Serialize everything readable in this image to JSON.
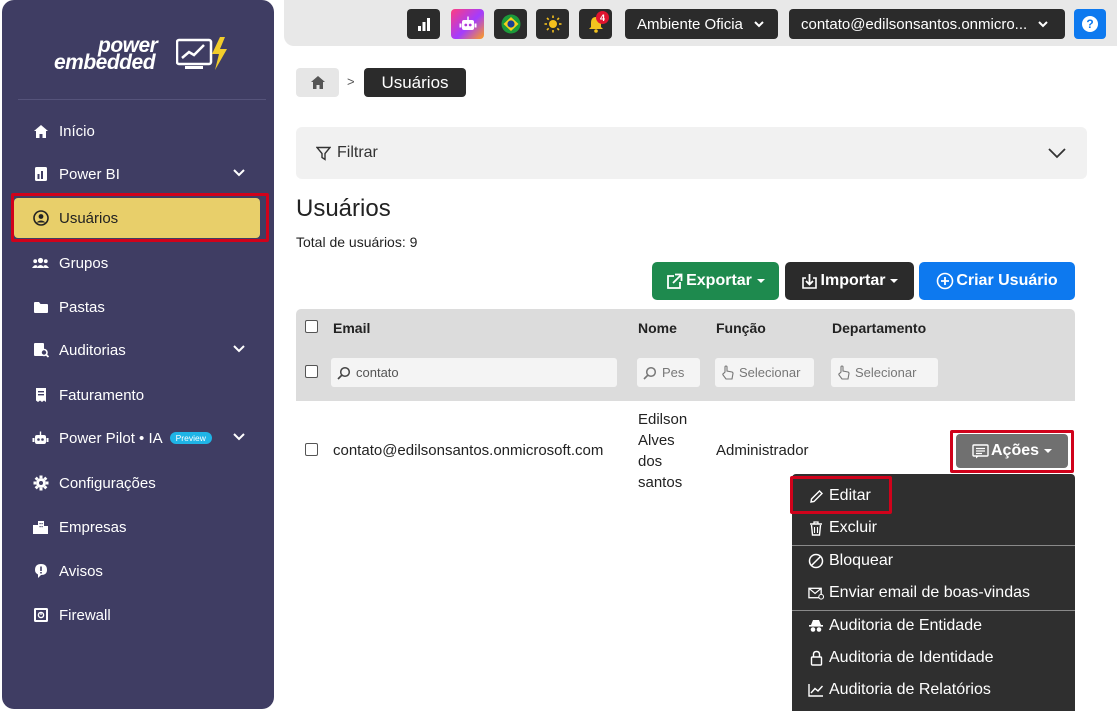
{
  "logo": {
    "line1": "power",
    "line2": "embedded"
  },
  "sidebar": {
    "items": [
      {
        "label": "Início",
        "icon": "home-icon"
      },
      {
        "label": "Power BI",
        "icon": "report-icon"
      },
      {
        "label": "Usuários",
        "icon": "user-circle-icon"
      },
      {
        "label": "Grupos",
        "icon": "users-icon"
      },
      {
        "label": "Pastas",
        "icon": "folder-icon"
      },
      {
        "label": "Auditorias",
        "icon": "audit-icon"
      },
      {
        "label": "Faturamento",
        "icon": "invoice-icon"
      },
      {
        "label": "Power Pilot • IA",
        "icon": "robot-icon",
        "badge": "Preview"
      },
      {
        "label": "Configurações",
        "icon": "gear-icon"
      },
      {
        "label": "Empresas",
        "icon": "building-icon"
      },
      {
        "label": "Avisos",
        "icon": "alert-icon"
      },
      {
        "label": "Firewall",
        "icon": "safe-icon"
      }
    ]
  },
  "topbar": {
    "notification_count": "4",
    "environment": "Ambiente Oficia",
    "account": "contato@edilsonsantos.onmicro..."
  },
  "breadcrumb": {
    "current": "Usuários"
  },
  "filter": {
    "label": "Filtrar"
  },
  "page": {
    "title": "Usuários",
    "total": "Total de usuários: 9"
  },
  "actions": {
    "export": "Exportar",
    "import": "Importar",
    "create": "Criar Usuário"
  },
  "table": {
    "headers": [
      "Email",
      "Nome",
      "Função",
      "Departamento"
    ],
    "filters": {
      "email_value": "contato",
      "name_placeholder": "Pes",
      "role_placeholder": "Selecionar",
      "dept_placeholder": "Selecionar"
    },
    "rows": [
      {
        "email": "contato@edilsonsantos.onmicrosoft.com",
        "name_lines": [
          "Edilson",
          "Alves",
          "dos",
          "santos"
        ],
        "role": "Administrador",
        "department": ""
      }
    ],
    "row_action": "Ações"
  },
  "menu": {
    "items": [
      "Editar",
      "Excluir",
      "Bloquear",
      "Enviar email de boas-vindas",
      "Auditoria de Entidade",
      "Auditoria de Identidade",
      "Auditoria de Relatórios"
    ]
  },
  "colors": {
    "sidebar": "#3f3d63",
    "active": "#e8cf6a",
    "highlight": "#d0021b",
    "export": "#1e8a4e",
    "import": "#2b2b2b",
    "create": "#0d79ef"
  }
}
